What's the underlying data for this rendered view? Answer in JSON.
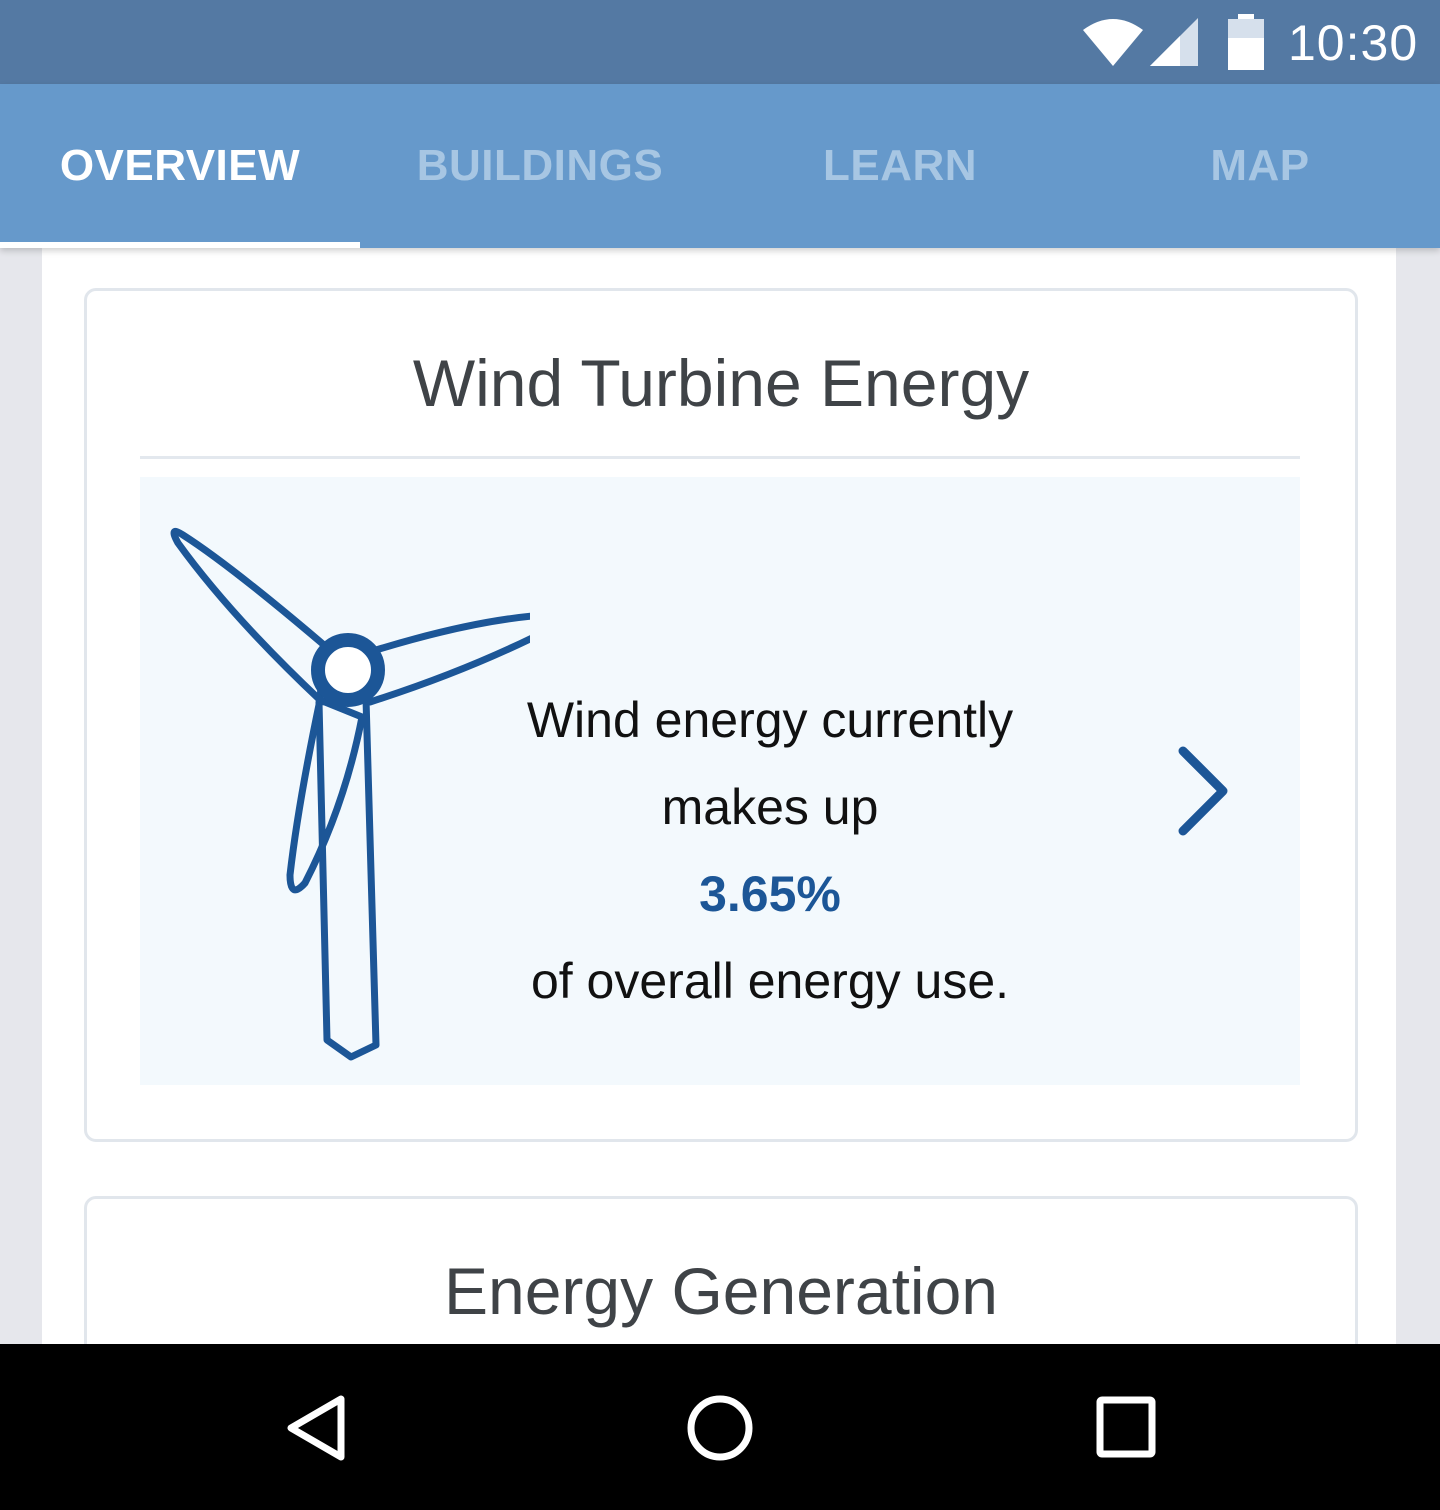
{
  "status_bar": {
    "time": "10:30",
    "icons": [
      "wifi-icon",
      "cell-signal-icon",
      "battery-icon"
    ]
  },
  "tabs": [
    {
      "label": "OVERVIEW",
      "active": true
    },
    {
      "label": "BUILDINGS",
      "active": false
    },
    {
      "label": "LEARN",
      "active": false
    },
    {
      "label": "MAP",
      "active": false
    }
  ],
  "wind_card": {
    "title": "Wind Turbine Energy",
    "line1": "Wind energy currently",
    "line2": "makes up",
    "percentage": "3.65%",
    "line3": "of overall energy use.",
    "icon": "wind-turbine-icon",
    "action_icon": "chevron-right-icon"
  },
  "generation_card": {
    "title": "Energy Generation"
  },
  "nav_bar": {
    "icons": [
      "back-icon",
      "home-icon",
      "recents-icon"
    ]
  },
  "colors": {
    "status_bar": "#5479a3",
    "tab_bar": "#6699cb",
    "tab_active": "#ffffff",
    "tab_inactive": "#a7c6e3",
    "accent": "#1c5697",
    "panel": "#f3f9fd"
  }
}
